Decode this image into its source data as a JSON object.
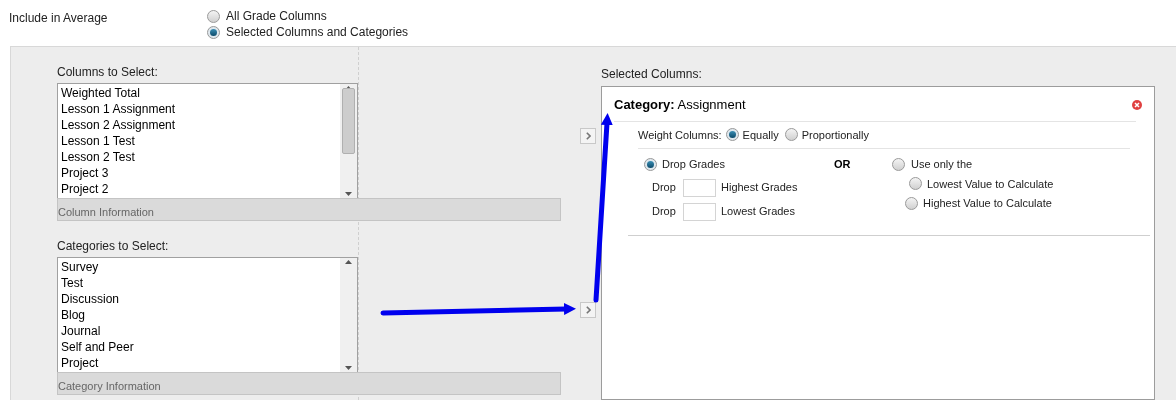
{
  "include_in_average": {
    "label": "Include in Average",
    "options": [
      {
        "label": "All Grade Columns",
        "selected": false
      },
      {
        "label": "Selected Columns and Categories",
        "selected": true
      }
    ]
  },
  "columns_to_select": {
    "label": "Columns to Select:",
    "items": [
      "Weighted Total",
      "Lesson 1 Assignment",
      "Lesson 2 Assignment",
      "Lesson 1 Test",
      "Lesson 2 Test",
      "Project 3",
      "Project 2"
    ],
    "info": "Column Information"
  },
  "categories_to_select": {
    "label": "Categories to Select:",
    "items": [
      "Survey",
      "Test",
      "Discussion",
      "Blog",
      "Journal",
      "Self and Peer",
      "Project"
    ],
    "info": "Category Information"
  },
  "selected_columns": {
    "label": "Selected Columns:",
    "category": {
      "title": "**Category:** Assignment",
      "weight": {
        "label": "Weight Columns:",
        "options": [
          {
            "label": "Equally",
            "selected": true
          },
          {
            "label": "Proportionally",
            "selected": false
          }
        ]
      },
      "drop": {
        "label": "Drop Grades",
        "selected": true,
        "rows": [
          {
            "prefix": "Drop",
            "suffix": "Highest Grades"
          },
          {
            "prefix": "Drop",
            "suffix": "Lowest Grades"
          }
        ]
      },
      "or": "OR",
      "use_only": {
        "label": "Use only the",
        "selected": false,
        "options": [
          {
            "label": "Lowest Value to Calculate",
            "selected": false
          },
          {
            "label": "Highest Value to Calculate",
            "selected": false
          }
        ]
      }
    }
  }
}
